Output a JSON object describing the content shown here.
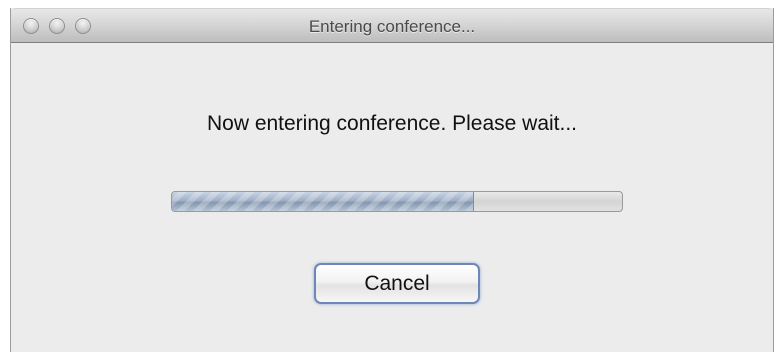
{
  "window": {
    "title": "Entering conference...",
    "controls": {
      "close_icon": "window-close-icon",
      "minimize_icon": "window-minimize-icon",
      "zoom_icon": "window-zoom-icon",
      "color": "#c6c6c6"
    }
  },
  "dialog": {
    "message": "Now entering conference. Please wait...",
    "progress": {
      "fraction": 0.67
    },
    "cancel_label": "Cancel"
  },
  "colors": {
    "window_background": "#ececec",
    "progress_fill": "#9fb0c6",
    "button_focus_ring": "#6d87b6"
  }
}
